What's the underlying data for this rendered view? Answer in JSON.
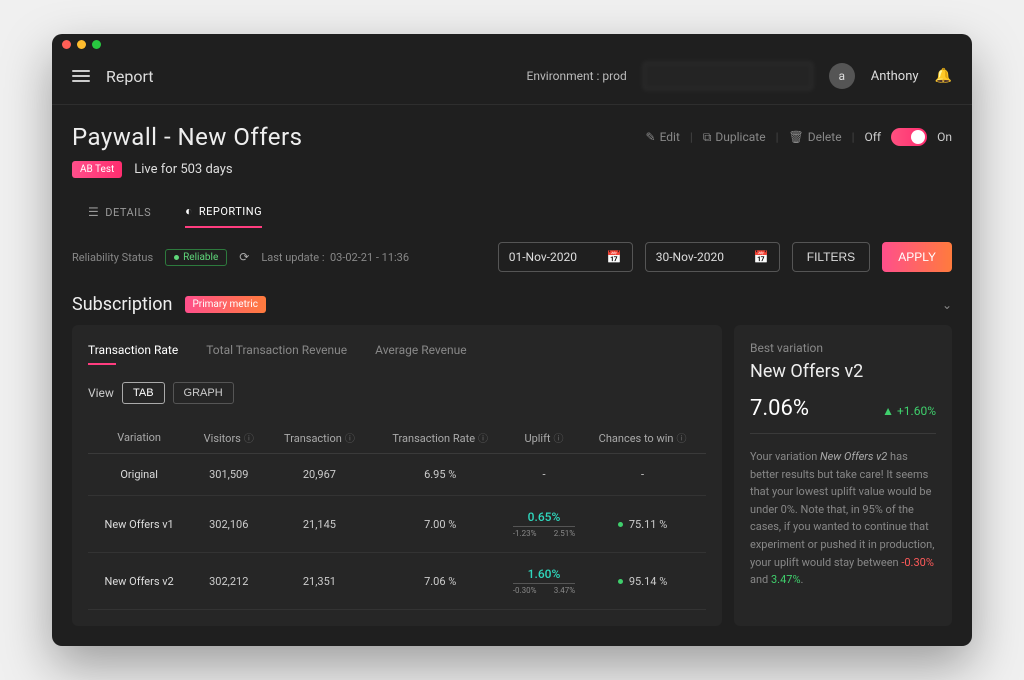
{
  "topbar": {
    "brand": "Report",
    "env_label": "Environment :",
    "env_value": "prod",
    "avatar_initial": "a",
    "username": "Anthony"
  },
  "header": {
    "title": "Paywall - New Offers",
    "edit": "Edit",
    "duplicate": "Duplicate",
    "delete": "Delete",
    "off": "Off",
    "on": "On"
  },
  "status": {
    "badge": "AB Test",
    "live_text": "Live for 503 days"
  },
  "tabs": {
    "details": "DETAILS",
    "reporting": "REPORTING"
  },
  "filters": {
    "reliability_label": "Reliability Status",
    "reliable": "Reliable",
    "last_update_label": "Last update :",
    "last_update_value": "03-02-21 - 11:36",
    "date_from": "01-Nov-2020",
    "date_to": "30-Nov-2020",
    "filters_btn": "FILTERS",
    "apply_btn": "APPLY"
  },
  "section": {
    "title": "Subscription",
    "primary_badge": "Primary metric"
  },
  "metric_tabs": {
    "m0": "Transaction Rate",
    "m1": "Total Transaction Revenue",
    "m2": "Average Revenue"
  },
  "view": {
    "label": "View",
    "tab": "TAB",
    "graph": "GRAPH"
  },
  "columns": {
    "c0": "Variation",
    "c1": "Visitors",
    "c2": "Transaction",
    "c3": "Transaction Rate",
    "c4": "Uplift",
    "c5": "Chances to win"
  },
  "rows": {
    "r0": {
      "name": "Original",
      "visitors": "301,509",
      "tx": "20,967",
      "rate": "6.95 %",
      "uplift": "-",
      "lo": "",
      "hi": "",
      "ctw": "-"
    },
    "r1": {
      "name": "New Offers v1",
      "visitors": "302,106",
      "tx": "21,145",
      "rate": "7.00 %",
      "uplift": "0.65%",
      "lo": "-1.23%",
      "hi": "2.51%",
      "ctw": "75.11 %"
    },
    "r2": {
      "name": "New Offers v2",
      "visitors": "302,212",
      "tx": "21,351",
      "rate": "7.06 %",
      "uplift": "1.60%",
      "lo": "-0.30%",
      "hi": "3.47%",
      "ctw": "95.14 %"
    }
  },
  "side": {
    "label": "Best variation",
    "title": "New Offers v2",
    "pct": "7.06%",
    "delta": "▲ +1.60%",
    "p1a": "Your variation ",
    "p1b": "New Offers v2",
    "p1c": " has better results but take care! It seems that your lowest uplift value would be under 0%. Note that, in 95% of the cases, if you wanted to continue that experiment or pushed it in production, your uplift would stay between ",
    "lo": "-0.30%",
    "mid": " and ",
    "hi": "3.47%",
    "tail": "."
  }
}
